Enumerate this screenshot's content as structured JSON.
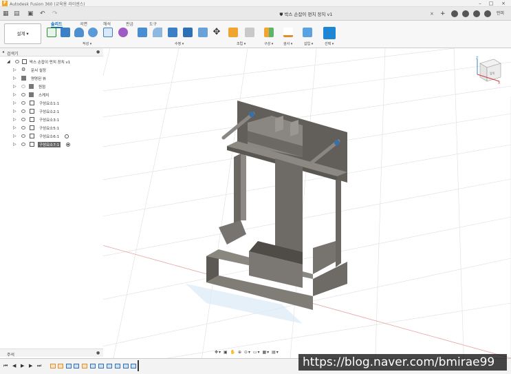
{
  "app": {
    "title": "Autodesk Fusion 360 (교육용 라이센스)",
    "logo_letter": "F",
    "document_title": "박스 손잡이 펀치 장치 v1",
    "profile_label": "민미"
  },
  "ribbon": {
    "workspace_label": "설계 ▾",
    "tabs": [
      "솔리드",
      "곡면",
      "해석",
      "판금",
      "도구"
    ],
    "groups": [
      "작성 ▾",
      "수정 ▾",
      "조립 ▾",
      "구성 ▾",
      "검사 ▾",
      "삽입 ▾",
      "선택 ▾"
    ]
  },
  "browser": {
    "title": "검색기",
    "items": [
      {
        "label": "박스 손잡이 펀치 장치 v1",
        "icon": "document-icon",
        "selected": false
      },
      {
        "label": "문서 설정",
        "icon": "gear-icon",
        "selected": false
      },
      {
        "label": "명명된 뷰",
        "icon": "folder-icon",
        "selected": false
      },
      {
        "label": "원점",
        "icon": "folder-icon",
        "selected": false
      },
      {
        "label": "스케치",
        "icon": "folder-icon",
        "selected": false
      },
      {
        "label": "구성요소1:1",
        "icon": "component-icon",
        "selected": false
      },
      {
        "label": "구성요소2:1",
        "icon": "component-icon",
        "selected": false
      },
      {
        "label": "구성요소3:1",
        "icon": "component-icon",
        "selected": false
      },
      {
        "label": "구성요소5:1",
        "icon": "component-icon",
        "selected": false
      },
      {
        "label": "구성요소6:1",
        "icon": "component-icon",
        "selected": false
      },
      {
        "label": "구성요소7:1",
        "icon": "component-icon",
        "selected": true
      }
    ]
  },
  "comments": {
    "title": "주석"
  },
  "watermark": "https://blog.naver.com/bmirae99",
  "viewcube": {
    "face_label": "앞쪽",
    "axes": [
      "Z",
      "X"
    ]
  },
  "colors": {
    "accent": "#0a6cc1",
    "model": "#6e6b66",
    "grid": "#d9d9d9"
  }
}
